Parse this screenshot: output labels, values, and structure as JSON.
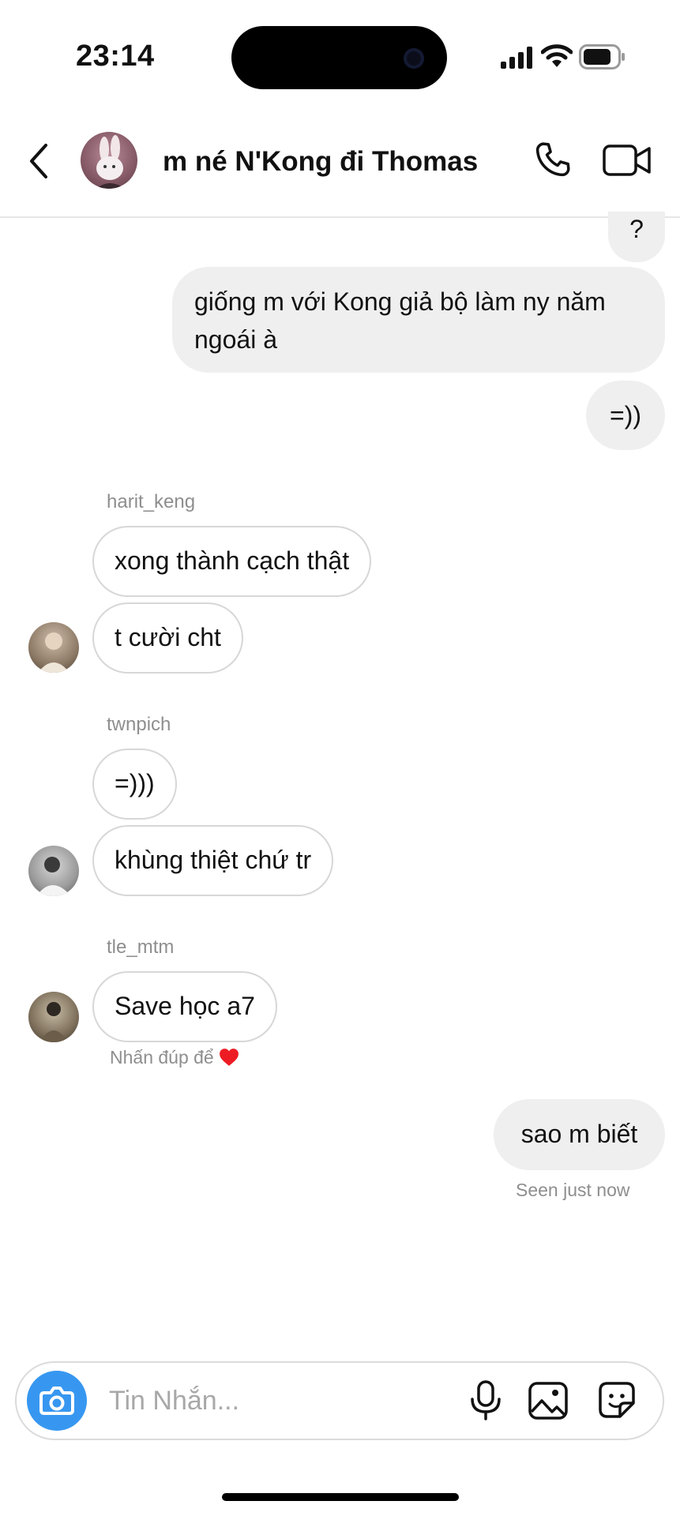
{
  "status_bar": {
    "time": "23:14"
  },
  "header": {
    "title": "m né N'Kong đi Thomas"
  },
  "messages": {
    "out_q": "?",
    "out_1": "giống m với Kong giả bộ làm ny năm",
    "out_1b": "ngoái à",
    "out_2": "=))",
    "harit_name": "harit_keng",
    "harit_1": "xong thành cạch thật",
    "harit_2": "t cười cht",
    "twn_name": "twnpich",
    "twn_1": "=)))",
    "twn_2": "khùng thiệt chứ tr",
    "tle_name": "tle_mtm",
    "tle_1": "Save học a7",
    "double_tap_hint": "Nhấn đúp để",
    "out_3": "sao m biết",
    "seen": "Seen just now"
  },
  "composer": {
    "placeholder": "Tin Nhắn..."
  },
  "colors": {
    "accent": "#3797f0",
    "outgoing_bubble": "#efefef",
    "heart": "#ed1c24"
  },
  "icons": [
    "back-chevron-icon",
    "phone-icon",
    "video-camera-icon",
    "camera-icon",
    "microphone-icon",
    "image-icon",
    "sticker-icon",
    "heart-icon"
  ]
}
